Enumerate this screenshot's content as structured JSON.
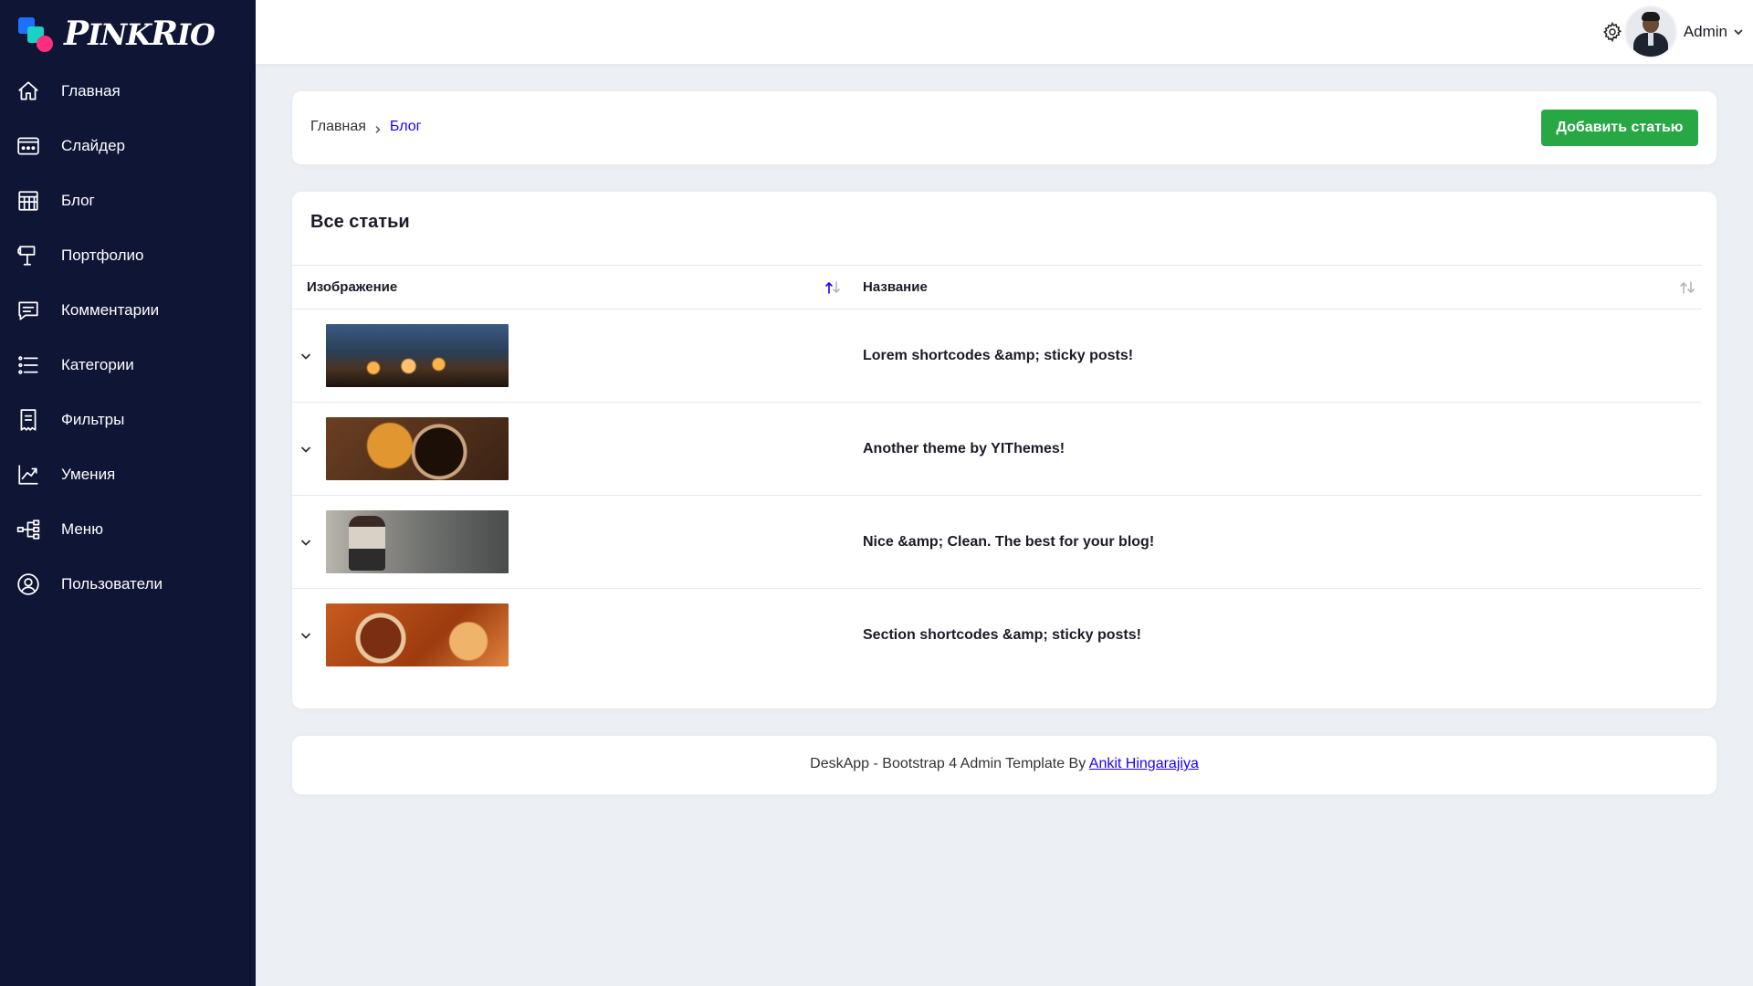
{
  "brand": {
    "name_first": "P",
    "name_rest1": "INK",
    "name_r": "R",
    "name_rest2": "IO"
  },
  "sidebar": {
    "items": [
      {
        "label": "Главная",
        "icon": "home-icon"
      },
      {
        "label": "Слайдер",
        "icon": "slider-icon"
      },
      {
        "label": "Блог",
        "icon": "blog-icon"
      },
      {
        "label": "Портфолио",
        "icon": "portfolio-icon"
      },
      {
        "label": "Комментарии",
        "icon": "comments-icon"
      },
      {
        "label": "Категории",
        "icon": "categories-icon"
      },
      {
        "label": "Фильтры",
        "icon": "filters-icon"
      },
      {
        "label": "Умения",
        "icon": "skills-icon"
      },
      {
        "label": "Меню",
        "icon": "menu-icon"
      },
      {
        "label": "Пользователи",
        "icon": "users-icon"
      }
    ]
  },
  "header": {
    "user_name": "Admin"
  },
  "breadcrumb": {
    "home": "Главная",
    "current": "Блог"
  },
  "actions": {
    "add_label": "Добавить статью"
  },
  "table": {
    "title": "Все статьи",
    "columns": [
      "Изображение",
      "Название"
    ],
    "rows": [
      {
        "title": "Lorem shortcodes &amp; sticky posts!"
      },
      {
        "title": "Another theme by YIThemes!"
      },
      {
        "title": "Nice &amp; Clean. The best for your blog!"
      },
      {
        "title": "Section shortcodes &amp; sticky posts!"
      }
    ]
  },
  "footer": {
    "text": "DeskApp - Bootstrap 4 Admin Template By ",
    "link": "Ankit Hingarajiya"
  },
  "colors": {
    "sidebar_bg": "#0f1535",
    "accent": "#1b00ff",
    "add_button": "#28a745",
    "page_bg": "#ecf0f4"
  }
}
